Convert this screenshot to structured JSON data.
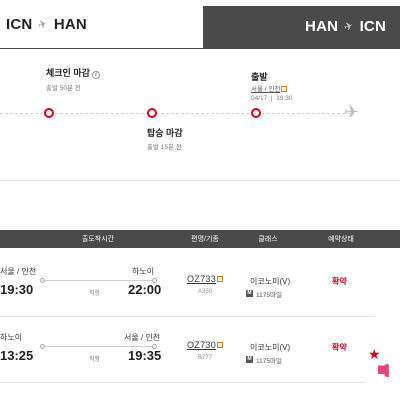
{
  "tabs": {
    "outbound": {
      "from": "ICN",
      "to": "HAN"
    },
    "inbound": {
      "from": "HAN",
      "to": "ICN"
    }
  },
  "timeline": {
    "checkin": {
      "label": "체크인 마감",
      "sub": "출발 50분 전"
    },
    "boarding": {
      "label": "탑승 마감",
      "sub": "출발 15분 전"
    },
    "departure": {
      "label": "출발",
      "place": "서울 / 인천",
      "date": "04/17",
      "time": "19:30"
    }
  },
  "table": {
    "headers": {
      "schedule": "출도착시간",
      "flight": "편명/기종",
      "class": "클래스",
      "status": "예약상태"
    },
    "rows": [
      {
        "dep_city": "서울 / 인천",
        "dep_time": "19:30",
        "arr_city": "하노이",
        "arr_time": "22:00",
        "route_type": "직항",
        "flight_no": "OZ733",
        "aircraft": "A350",
        "cabin": "이코노미(V)",
        "miles": "1175마일",
        "status": "확약"
      },
      {
        "dep_city": "하노이",
        "dep_time": "13:25",
        "arr_city": "서울 / 인천",
        "arr_time": "19:35",
        "route_type": "직항",
        "flight_no": "OZ730",
        "aircraft": "B777",
        "cabin": "이코노미(V)",
        "miles": "1175마일",
        "status": "확약"
      }
    ]
  },
  "icons": {
    "plane_small": "plane-icon",
    "info": "info-icon",
    "external": "external-link-icon",
    "mileage_badge": "M"
  },
  "colors": {
    "accent": "#d0021b",
    "dark_tab": "#4a4a4a",
    "link_orange": "#e07a00"
  }
}
